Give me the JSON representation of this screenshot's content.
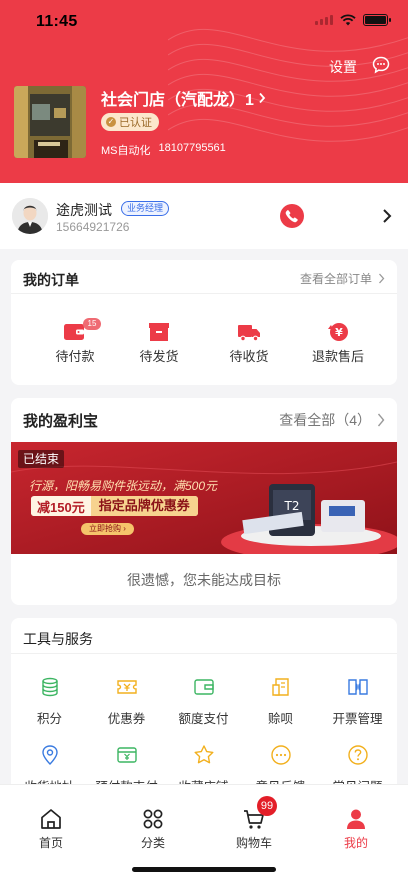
{
  "status": {
    "time": "11:45"
  },
  "header": {
    "settings_label": "设置",
    "store_name": "社会门店（汽配龙）1",
    "verified_label": "已认证",
    "account_name": "MS自动化",
    "account_phone": "18107795561"
  },
  "contact": {
    "name": "途虎测试",
    "role": "业务经理",
    "phone": "15664921726"
  },
  "orders": {
    "title": "我的订单",
    "view_all": "查看全部订单",
    "items": [
      {
        "label": "待付款",
        "badge": "15",
        "icon": "wallet-icon"
      },
      {
        "label": "待发货",
        "icon": "box-icon"
      },
      {
        "label": "待收货",
        "icon": "truck-icon"
      },
      {
        "label": "退款售后",
        "icon": "refund-icon"
      }
    ]
  },
  "profit": {
    "title": "我的盈利宝",
    "view_all": "查看全部（4）",
    "banner": {
      "status": "已结束",
      "subtitle": "行源，阳畅易购件张远动，满500元",
      "amount": "减150元",
      "coupon": "指定品牌优惠券",
      "cta": "立即抢购 ›"
    },
    "message": "很遗憾，您未能达成目标"
  },
  "tools": {
    "title": "工具与服务",
    "items": [
      {
        "label": "积分",
        "icon": "points-icon",
        "color": "#3cb562"
      },
      {
        "label": "优惠券",
        "icon": "coupon-icon",
        "color": "#f2b01e"
      },
      {
        "label": "额度支付",
        "icon": "wallet-icon",
        "color": "#3cb562"
      },
      {
        "label": "赊呗",
        "icon": "credit-icon",
        "color": "#f2b01e"
      },
      {
        "label": "开票管理",
        "icon": "invoice-icon",
        "color": "#3a7be0"
      },
      {
        "label": "收货地址",
        "icon": "location-icon",
        "color": "#3a7be0"
      },
      {
        "label": "预付款支付",
        "icon": "prepay-icon",
        "color": "#3cb562"
      },
      {
        "label": "收藏店铺",
        "icon": "star-icon",
        "color": "#f2b01e"
      },
      {
        "label": "意见反馈",
        "icon": "feedback-icon",
        "color": "#f2b01e"
      },
      {
        "label": "常见问题",
        "icon": "question-icon",
        "color": "#f2b01e"
      }
    ]
  },
  "tabbar": {
    "items": [
      {
        "label": "首页",
        "icon": "home-icon"
      },
      {
        "label": "分类",
        "icon": "category-icon"
      },
      {
        "label": "购物车",
        "icon": "cart-icon",
        "badge": "99"
      },
      {
        "label": "我的",
        "icon": "profile-icon",
        "active": true
      }
    ]
  },
  "colors": {
    "brand": "#ec3b47",
    "verified": "#fce7cc",
    "link": "#3a6ee8"
  }
}
